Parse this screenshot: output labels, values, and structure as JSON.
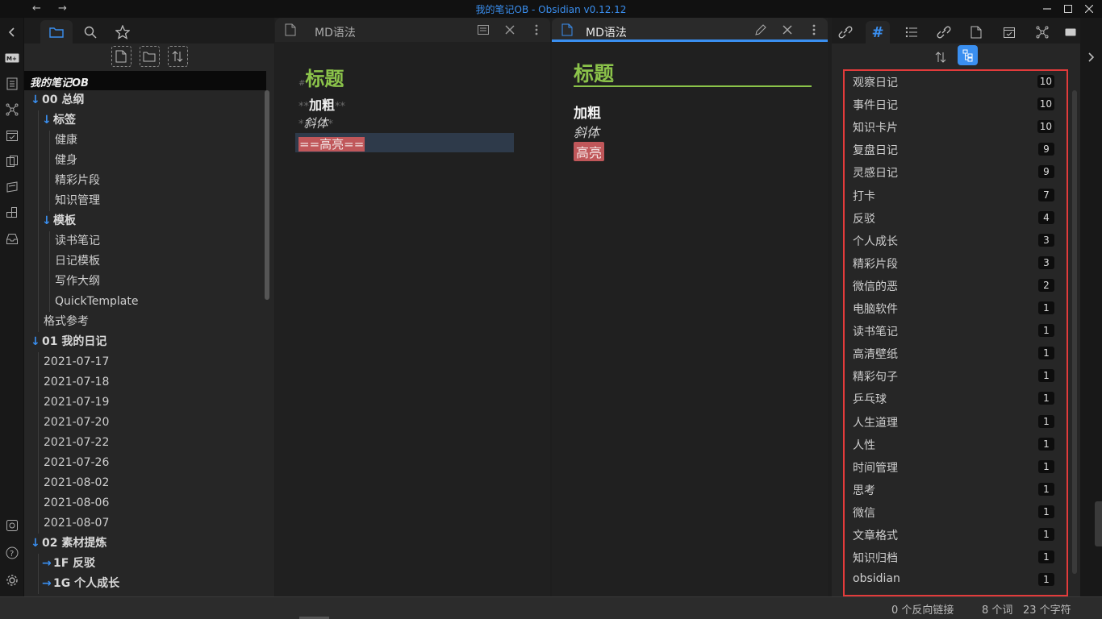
{
  "window": {
    "title": "我的笔记OB - Obsidian v0.12.12"
  },
  "left_sidebar": {
    "vault_name": "我的笔记OB",
    "tree": [
      {
        "label": "00 总纲",
        "type": "folder",
        "expanded": true,
        "depth": 0
      },
      {
        "label": "标签",
        "type": "folder",
        "expanded": true,
        "depth": 1
      },
      {
        "label": "健康",
        "type": "file",
        "depth": 2
      },
      {
        "label": "健身",
        "type": "file",
        "depth": 2
      },
      {
        "label": "精彩片段",
        "type": "file",
        "depth": 2
      },
      {
        "label": "知识管理",
        "type": "file",
        "depth": 2
      },
      {
        "label": "模板",
        "type": "folder",
        "expanded": true,
        "depth": 1
      },
      {
        "label": "读书笔记",
        "type": "file",
        "depth": 2
      },
      {
        "label": "日记模板",
        "type": "file",
        "depth": 2
      },
      {
        "label": "写作大纲",
        "type": "file",
        "depth": 2
      },
      {
        "label": "QuickTemplate",
        "type": "file",
        "depth": 2
      },
      {
        "label": "格式参考",
        "type": "file",
        "depth": 1
      },
      {
        "label": "01 我的日记",
        "type": "folder",
        "expanded": true,
        "depth": 0
      },
      {
        "label": "2021-07-17",
        "type": "file",
        "depth": 1
      },
      {
        "label": "2021-07-18",
        "type": "file",
        "depth": 1
      },
      {
        "label": "2021-07-19",
        "type": "file",
        "depth": 1
      },
      {
        "label": "2021-07-20",
        "type": "file",
        "depth": 1
      },
      {
        "label": "2021-07-22",
        "type": "file",
        "depth": 1
      },
      {
        "label": "2021-07-26",
        "type": "file",
        "depth": 1
      },
      {
        "label": "2021-08-02",
        "type": "file",
        "depth": 1
      },
      {
        "label": "2021-08-06",
        "type": "file",
        "depth": 1
      },
      {
        "label": "2021-08-07",
        "type": "file",
        "depth": 1
      },
      {
        "label": "02 素材提炼",
        "type": "folder",
        "expanded": true,
        "depth": 0
      },
      {
        "label": "1F 反驳",
        "type": "folder",
        "expanded": false,
        "depth": 1
      },
      {
        "label": "1G 个人成长",
        "type": "folder",
        "expanded": false,
        "depth": 1
      }
    ]
  },
  "source_pane": {
    "tab_title": "MD语法",
    "heading_mark": "#",
    "heading": "标题",
    "bold_mark": "**",
    "bold": "加粗",
    "italic_mark": "*",
    "italic": "斜体",
    "highlight_line": "==高亮=="
  },
  "preview_pane": {
    "tab_title": "MD语法",
    "heading": "标题",
    "bold": "加粗",
    "italic": "斜体",
    "highlight": "高亮"
  },
  "tag_pane": {
    "tags": [
      {
        "name": "观察日记",
        "count": "10"
      },
      {
        "name": "事件日记",
        "count": "10"
      },
      {
        "name": "知识卡片",
        "count": "10"
      },
      {
        "name": "复盘日记",
        "count": "9"
      },
      {
        "name": "灵感日记",
        "count": "9"
      },
      {
        "name": "打卡",
        "count": "7"
      },
      {
        "name": "反驳",
        "count": "4"
      },
      {
        "name": "个人成长",
        "count": "3"
      },
      {
        "name": "精彩片段",
        "count": "3"
      },
      {
        "name": "微信的恶",
        "count": "2"
      },
      {
        "name": "电脑软件",
        "count": "1"
      },
      {
        "name": "读书笔记",
        "count": "1"
      },
      {
        "name": "高清壁纸",
        "count": "1"
      },
      {
        "name": "精彩句子",
        "count": "1"
      },
      {
        "name": "乒乓球",
        "count": "1"
      },
      {
        "name": "人生道理",
        "count": "1"
      },
      {
        "name": "人性",
        "count": "1"
      },
      {
        "name": "时间管理",
        "count": "1"
      },
      {
        "name": "思考",
        "count": "1"
      },
      {
        "name": "微信",
        "count": "1"
      },
      {
        "name": "文章格式",
        "count": "1"
      },
      {
        "name": "知识归档",
        "count": "1"
      },
      {
        "name": "obsidian",
        "count": "1"
      }
    ]
  },
  "status_bar": {
    "backlinks": "0 个反向链接",
    "words": "8 个词",
    "chars": "23 个字符"
  },
  "colors": {
    "accent": "#3a8ff0",
    "heading_green": "#8bc34a",
    "highlight_red": "#c0575a",
    "annotation_red": "#e23b3b"
  }
}
